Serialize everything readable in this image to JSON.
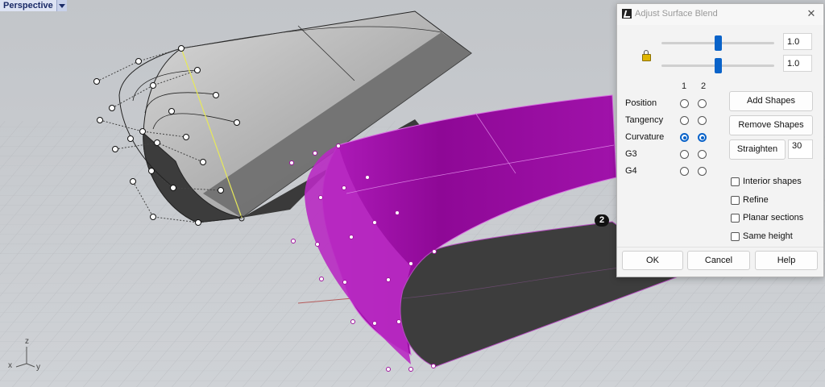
{
  "viewport": {
    "name": "Perspective",
    "axes": {
      "x": "x",
      "y": "y",
      "z": "z"
    },
    "edge_badge": "2"
  },
  "dialog": {
    "title": "Adjust Surface Blend",
    "slider1_value": "1.0",
    "slider2_value": "1.0",
    "slider1_level": 0.5,
    "slider2_level": 0.5,
    "columns": [
      "1",
      "2"
    ],
    "continuity_rows": [
      {
        "label": "Position",
        "edge1": false,
        "edge2": false
      },
      {
        "label": "Tangency",
        "edge1": false,
        "edge2": false
      },
      {
        "label": "Curvature",
        "edge1": true,
        "edge2": true
      },
      {
        "label": "G3",
        "edge1": false,
        "edge2": false
      },
      {
        "label": "G4",
        "edge1": false,
        "edge2": false
      }
    ],
    "buttons": {
      "add_shapes": "Add Shapes",
      "remove_shapes": "Remove Shapes",
      "straighten": "Straighten",
      "straighten_value": "30",
      "ok": "OK",
      "cancel": "Cancel",
      "help": "Help"
    },
    "checkboxes": [
      {
        "label": "Interior shapes",
        "checked": false
      },
      {
        "label": "Refine",
        "checked": false
      },
      {
        "label": "Planar sections",
        "checked": false
      },
      {
        "label": "Same height",
        "checked": false
      }
    ],
    "colors": {
      "accent": "#0a63c9",
      "blend_surface": "#9b0aa3"
    }
  }
}
